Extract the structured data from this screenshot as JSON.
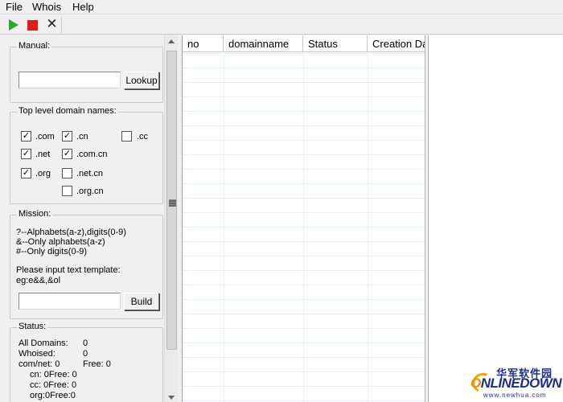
{
  "menu": {
    "file": "File",
    "whois": "Whois",
    "help": "Help"
  },
  "toolbar": {
    "play_icon": "play-icon",
    "stop_icon": "stop-icon",
    "close_icon": "close-icon",
    "close_glyph": "✕"
  },
  "manual": {
    "title": "Manual:",
    "input_value": "",
    "lookup_label": "Lookup"
  },
  "tld": {
    "title": "Top level domain names:",
    "items": [
      {
        "label": ".com",
        "checked": true
      },
      {
        "label": ".cn",
        "checked": true
      },
      {
        "label": ".cc",
        "checked": false
      },
      {
        "label": ".net",
        "checked": true
      },
      {
        "label": ".com.cn",
        "checked": true
      },
      {
        "label": ".org",
        "checked": true
      },
      {
        "label": ".net.cn",
        "checked": false
      },
      {
        "label": ".org.cn",
        "checked": false
      }
    ]
  },
  "mission": {
    "title": "Mission:",
    "hint1": "?--Alphabets(a-z),digits(0-9)",
    "hint2": "&--Only alphabets(a-z)",
    "hint3": "#--Only digits(0-9)",
    "template_label": "Please input text template:",
    "example": "eg:e&&,&ol",
    "input_value": "",
    "build_label": "Build"
  },
  "status": {
    "title": "Status:",
    "all_domains_label": "All Domains:",
    "all_domains_value": "0",
    "whoised_label": "Whoised:",
    "whoised_value": "0",
    "comnet_text": "com/net: 0",
    "comnet_free": "Free: 0",
    "cn_text": "cn: 0Free: 0",
    "cc_text": "cc: 0Free: 0",
    "org_text": "org:0Free:0"
  },
  "table": {
    "columns": [
      "no",
      "domainname",
      "Status",
      "Creation Da"
    ]
  },
  "watermark": {
    "cn": "华军软件园",
    "logo_o": "O",
    "logo_rest": "NLINEDOWN",
    "url": "www.newhua.com"
  }
}
